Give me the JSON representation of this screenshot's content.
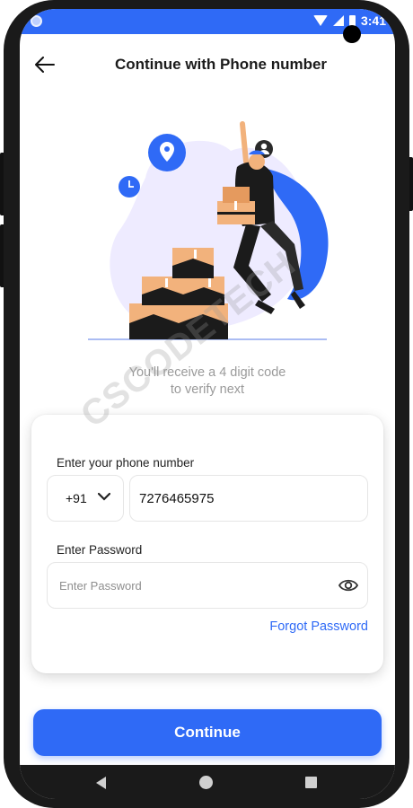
{
  "status_bar": {
    "time": "3:41",
    "icons": [
      "wifi-icon",
      "signal-icon",
      "battery-icon"
    ]
  },
  "header": {
    "title": "Continue with Phone number",
    "back_icon": "arrow-left-icon"
  },
  "info": {
    "line1": "You'll receive a 4 digit code",
    "line2": "to verify next"
  },
  "watermark": "CSCODETECH",
  "form": {
    "phone_label": "Enter your phone number",
    "country_code": "+91",
    "phone_value": "7276465975",
    "password_label": "Enter Password",
    "password_placeholder": "Enter Password",
    "forgot_label": "Forgot Password"
  },
  "continue_label": "Continue",
  "colors": {
    "accent": "#2f6af6",
    "text_muted": "#9a9a9a",
    "illustration_bg": "#eeebff",
    "box": "#f2b27c",
    "box_dark": "#1b1b1b"
  }
}
